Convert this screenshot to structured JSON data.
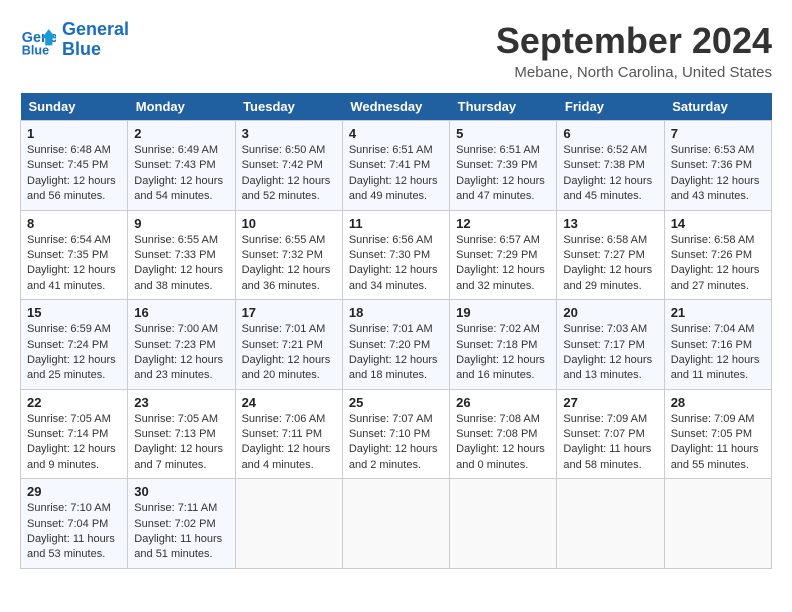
{
  "header": {
    "logo_line1": "General",
    "logo_line2": "Blue",
    "title": "September 2024",
    "subtitle": "Mebane, North Carolina, United States"
  },
  "weekdays": [
    "Sunday",
    "Monday",
    "Tuesday",
    "Wednesday",
    "Thursday",
    "Friday",
    "Saturday"
  ],
  "weeks": [
    [
      {
        "day": "1",
        "sunrise": "6:48 AM",
        "sunset": "7:45 PM",
        "daylight": "12 hours and 56 minutes."
      },
      {
        "day": "2",
        "sunrise": "6:49 AM",
        "sunset": "7:43 PM",
        "daylight": "12 hours and 54 minutes."
      },
      {
        "day": "3",
        "sunrise": "6:50 AM",
        "sunset": "7:42 PM",
        "daylight": "12 hours and 52 minutes."
      },
      {
        "day": "4",
        "sunrise": "6:51 AM",
        "sunset": "7:41 PM",
        "daylight": "12 hours and 49 minutes."
      },
      {
        "day": "5",
        "sunrise": "6:51 AM",
        "sunset": "7:39 PM",
        "daylight": "12 hours and 47 minutes."
      },
      {
        "day": "6",
        "sunrise": "6:52 AM",
        "sunset": "7:38 PM",
        "daylight": "12 hours and 45 minutes."
      },
      {
        "day": "7",
        "sunrise": "6:53 AM",
        "sunset": "7:36 PM",
        "daylight": "12 hours and 43 minutes."
      }
    ],
    [
      {
        "day": "8",
        "sunrise": "6:54 AM",
        "sunset": "7:35 PM",
        "daylight": "12 hours and 41 minutes."
      },
      {
        "day": "9",
        "sunrise": "6:55 AM",
        "sunset": "7:33 PM",
        "daylight": "12 hours and 38 minutes."
      },
      {
        "day": "10",
        "sunrise": "6:55 AM",
        "sunset": "7:32 PM",
        "daylight": "12 hours and 36 minutes."
      },
      {
        "day": "11",
        "sunrise": "6:56 AM",
        "sunset": "7:30 PM",
        "daylight": "12 hours and 34 minutes."
      },
      {
        "day": "12",
        "sunrise": "6:57 AM",
        "sunset": "7:29 PM",
        "daylight": "12 hours and 32 minutes."
      },
      {
        "day": "13",
        "sunrise": "6:58 AM",
        "sunset": "7:27 PM",
        "daylight": "12 hours and 29 minutes."
      },
      {
        "day": "14",
        "sunrise": "6:58 AM",
        "sunset": "7:26 PM",
        "daylight": "12 hours and 27 minutes."
      }
    ],
    [
      {
        "day": "15",
        "sunrise": "6:59 AM",
        "sunset": "7:24 PM",
        "daylight": "12 hours and 25 minutes."
      },
      {
        "day": "16",
        "sunrise": "7:00 AM",
        "sunset": "7:23 PM",
        "daylight": "12 hours and 23 minutes."
      },
      {
        "day": "17",
        "sunrise": "7:01 AM",
        "sunset": "7:21 PM",
        "daylight": "12 hours and 20 minutes."
      },
      {
        "day": "18",
        "sunrise": "7:01 AM",
        "sunset": "7:20 PM",
        "daylight": "12 hours and 18 minutes."
      },
      {
        "day": "19",
        "sunrise": "7:02 AM",
        "sunset": "7:18 PM",
        "daylight": "12 hours and 16 minutes."
      },
      {
        "day": "20",
        "sunrise": "7:03 AM",
        "sunset": "7:17 PM",
        "daylight": "12 hours and 13 minutes."
      },
      {
        "day": "21",
        "sunrise": "7:04 AM",
        "sunset": "7:16 PM",
        "daylight": "12 hours and 11 minutes."
      }
    ],
    [
      {
        "day": "22",
        "sunrise": "7:05 AM",
        "sunset": "7:14 PM",
        "daylight": "12 hours and 9 minutes."
      },
      {
        "day": "23",
        "sunrise": "7:05 AM",
        "sunset": "7:13 PM",
        "daylight": "12 hours and 7 minutes."
      },
      {
        "day": "24",
        "sunrise": "7:06 AM",
        "sunset": "7:11 PM",
        "daylight": "12 hours and 4 minutes."
      },
      {
        "day": "25",
        "sunrise": "7:07 AM",
        "sunset": "7:10 PM",
        "daylight": "12 hours and 2 minutes."
      },
      {
        "day": "26",
        "sunrise": "7:08 AM",
        "sunset": "7:08 PM",
        "daylight": "12 hours and 0 minutes."
      },
      {
        "day": "27",
        "sunrise": "7:09 AM",
        "sunset": "7:07 PM",
        "daylight": "11 hours and 58 minutes."
      },
      {
        "day": "28",
        "sunrise": "7:09 AM",
        "sunset": "7:05 PM",
        "daylight": "11 hours and 55 minutes."
      }
    ],
    [
      {
        "day": "29",
        "sunrise": "7:10 AM",
        "sunset": "7:04 PM",
        "daylight": "11 hours and 53 minutes."
      },
      {
        "day": "30",
        "sunrise": "7:11 AM",
        "sunset": "7:02 PM",
        "daylight": "11 hours and 51 minutes."
      },
      null,
      null,
      null,
      null,
      null
    ]
  ]
}
